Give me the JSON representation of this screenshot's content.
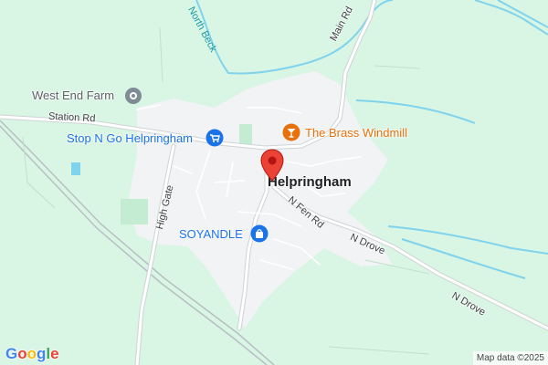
{
  "map": {
    "settlement_label": "Helpringham",
    "colors": {
      "land": "#d9f5e4",
      "settlement": "#f1f3f4",
      "road": "#ffffff",
      "road_outline": "#cfd3d6",
      "rail": "#b8bfc4",
      "water": "#7fd3ec",
      "pin": "#ea4335"
    }
  },
  "roads": {
    "station_rd": "Station Rd",
    "main_rd": "Main Rd",
    "high_gate": "High Gate",
    "n_fen_rd": "N Fen Rd",
    "n_drove_1": "N Drove",
    "n_drove_2": "N Drove"
  },
  "waterways": {
    "north_beck": "North Beck"
  },
  "pois": {
    "west_end_farm": {
      "label": "West End Farm",
      "icon": "place-icon",
      "color": "#5f6368"
    },
    "stop_n_go": {
      "label": "Stop N Go Helpringham",
      "icon": "shopping-cart-icon",
      "color": "#1a73e8"
    },
    "brass_windmill": {
      "label": "The Brass Windmill",
      "icon": "cocktail-icon",
      "color": "#e8710a"
    },
    "soyandle": {
      "label": "SOYANDLE",
      "icon": "shopping-bag-icon",
      "color": "#1a73e8"
    }
  },
  "footer": {
    "logo_text": "Google",
    "attribution": "Map data ©2025"
  },
  "marker": {
    "icon": "map-pin-icon"
  }
}
